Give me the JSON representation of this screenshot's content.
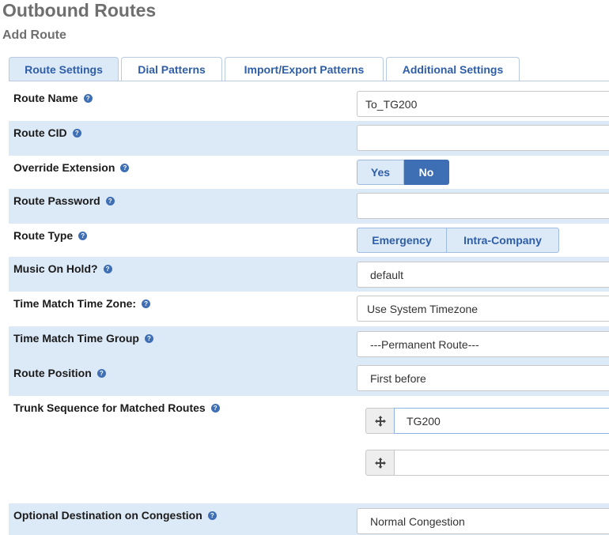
{
  "page": {
    "title": "Outbound Routes",
    "subtitle": "Add Route"
  },
  "tabs": [
    {
      "label": "Route Settings",
      "active": true
    },
    {
      "label": "Dial Patterns",
      "active": false
    },
    {
      "label": "Import/Export Patterns",
      "active": false
    },
    {
      "label": "Additional Settings",
      "active": false
    }
  ],
  "form": {
    "route_name": {
      "label": "Route Name",
      "value": "To_TG200"
    },
    "route_cid": {
      "label": "Route CID",
      "value": ""
    },
    "override_extension": {
      "label": "Override Extension",
      "options": [
        "Yes",
        "No"
      ],
      "selected": "No"
    },
    "route_password": {
      "label": "Route Password",
      "value": ""
    },
    "route_type": {
      "label": "Route Type",
      "options": [
        "Emergency",
        "Intra-Company"
      ]
    },
    "music_on_hold": {
      "label": "Music On Hold?",
      "value": "default"
    },
    "time_zone": {
      "label": "Time Match Time Zone:",
      "value": "Use System Timezone"
    },
    "time_group": {
      "label": "Time Match Time Group",
      "value": "---Permanent Route---"
    },
    "route_position": {
      "label": "Route Position",
      "value": "First before"
    },
    "trunk_sequence": {
      "label": "Trunk Sequence for Matched Routes",
      "trunks": [
        "TG200",
        ""
      ]
    },
    "congestion": {
      "label": "Optional Destination on Congestion",
      "value": "Normal Congestion"
    }
  },
  "colors": {
    "accent": "#3e6fb5",
    "row_shade": "#dce9f7",
    "title_gray": "#6f6f6f"
  }
}
